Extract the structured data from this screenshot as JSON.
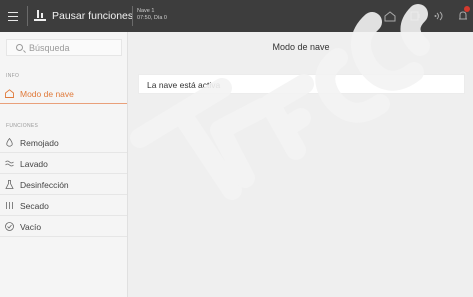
{
  "topbar": {
    "pause_label": "Pausar funciones",
    "nave_line1": "Nave 1",
    "nave_line2": "07:50, Día 0",
    "icons": [
      "menu-icon",
      "pause-functions-icon",
      "house-icon",
      "screen-icon",
      "wifi-icon",
      "bell-icon"
    ],
    "badge_color": "#d53a2e"
  },
  "sidebar": {
    "search_placeholder": "Búsqueda",
    "section_info": "INFO",
    "active_item": "Modo de nave",
    "section_functions": "FUNCIONES",
    "items": [
      {
        "label": "Remojado",
        "icon": "droplet-icon"
      },
      {
        "label": "Lavado",
        "icon": "water-waves-icon"
      },
      {
        "label": "Desinfección",
        "icon": "flask-icon"
      },
      {
        "label": "Secado",
        "icon": "heat-icon"
      },
      {
        "label": "Vacío",
        "icon": "check-circle-icon"
      }
    ]
  },
  "main": {
    "title": "Modo de nave",
    "status": "La nave está activa"
  },
  "colors": {
    "accent": "#e07a3a",
    "topbar": "#3d3d3d"
  }
}
